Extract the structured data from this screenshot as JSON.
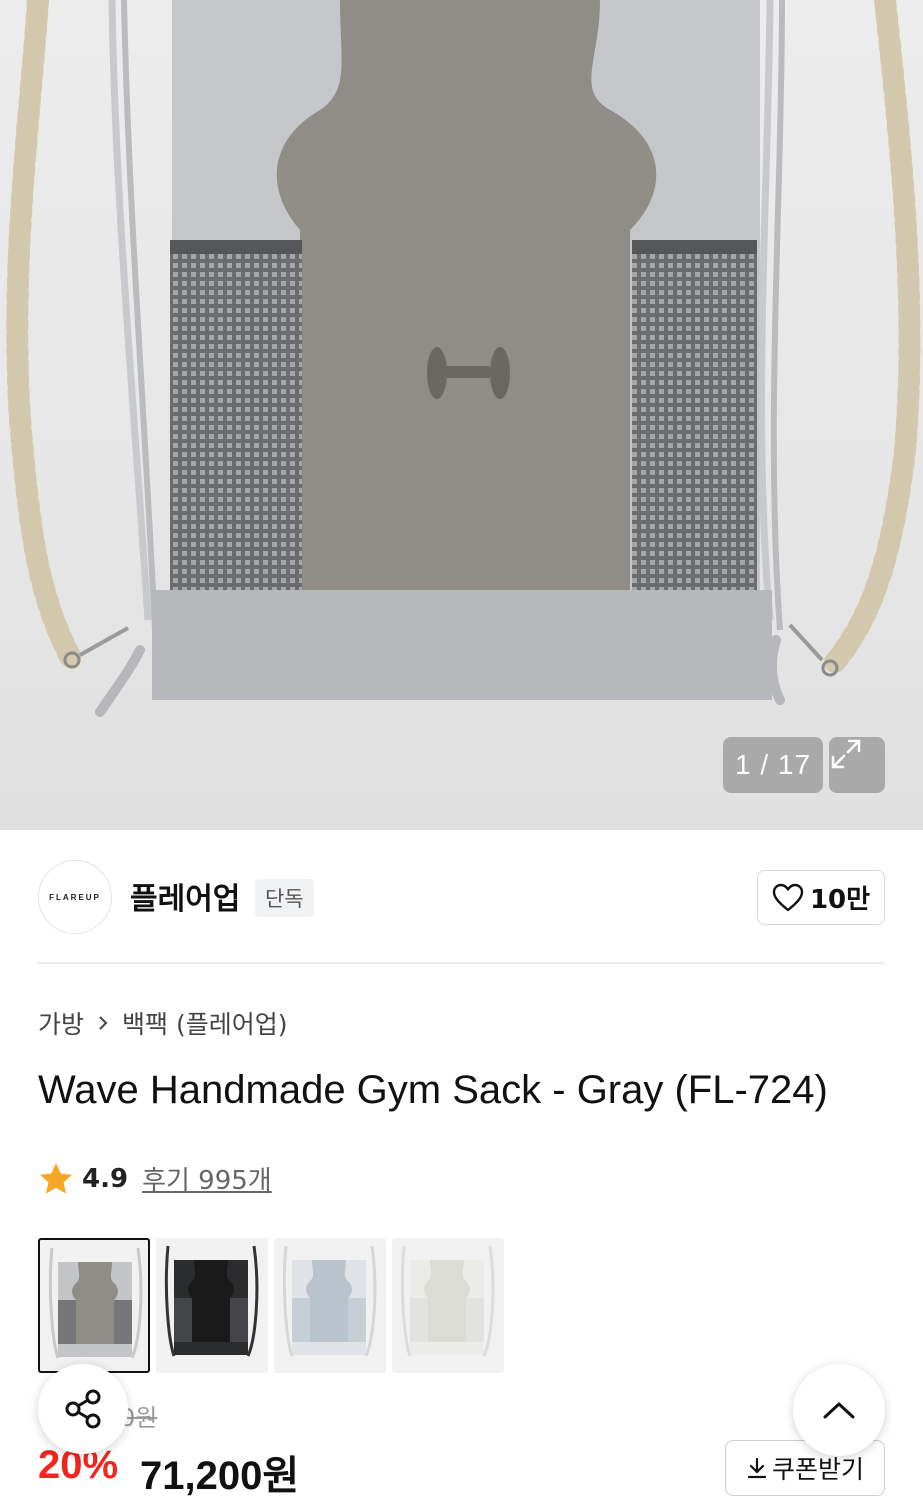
{
  "gallery": {
    "counter": "1 / 17",
    "image_alt": "gym-sack-product-photo"
  },
  "brand": {
    "logo_text": "FLAREUP",
    "name": "플레어업",
    "badge": "단독",
    "likes": "10만"
  },
  "breadcrumb": {
    "category": "가방",
    "subcategory": "백팩 (플레어업)"
  },
  "product": {
    "title": "Wave Handmade Gym Sack - Gray (FL-724)",
    "rating": "4.9",
    "reviews": "후기 995개",
    "original_price": "0원",
    "discount": "20%",
    "price": "71,200원"
  },
  "color_options": [
    "gray",
    "black",
    "light-blue",
    "white"
  ],
  "actions": {
    "coupon": "쿠폰받기"
  },
  "colors": {
    "accent_red": "#f1261d",
    "star": "#f5a623"
  }
}
